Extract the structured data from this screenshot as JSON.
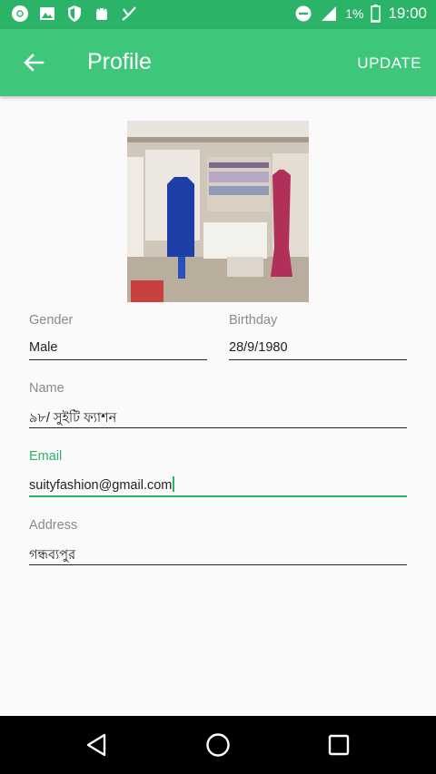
{
  "status_bar": {
    "time": "19:00",
    "battery_percent": "1%",
    "left_icons": [
      "chrome-icon",
      "image-icon",
      "shield-icon",
      "android-icon",
      "checkmark-icon"
    ],
    "right_icons": [
      "do-not-disturb-icon",
      "signal-icon",
      "battery-icon"
    ],
    "color": "#2bb368"
  },
  "toolbar": {
    "title": "Profile",
    "update_label": "UPDATE",
    "color": "#3ec77a"
  },
  "profile_photo": {
    "subject": "clothing boutique interior"
  },
  "fields": {
    "gender": {
      "label": "Gender",
      "value": "Male"
    },
    "birthday": {
      "label": "Birthday",
      "value": "28/9/1980"
    },
    "name": {
      "label": "Name",
      "value": "৯৮/ সুইটি ফ্যাশন"
    },
    "email": {
      "label": "Email",
      "value": "suityfashion@gmail.com",
      "focused": true
    },
    "address": {
      "label": "Address",
      "value": "গন্ধব্যপুর"
    }
  },
  "nav_bar": {
    "buttons": [
      "back-triangle-icon",
      "home-circle-icon",
      "recents-square-icon"
    ]
  }
}
